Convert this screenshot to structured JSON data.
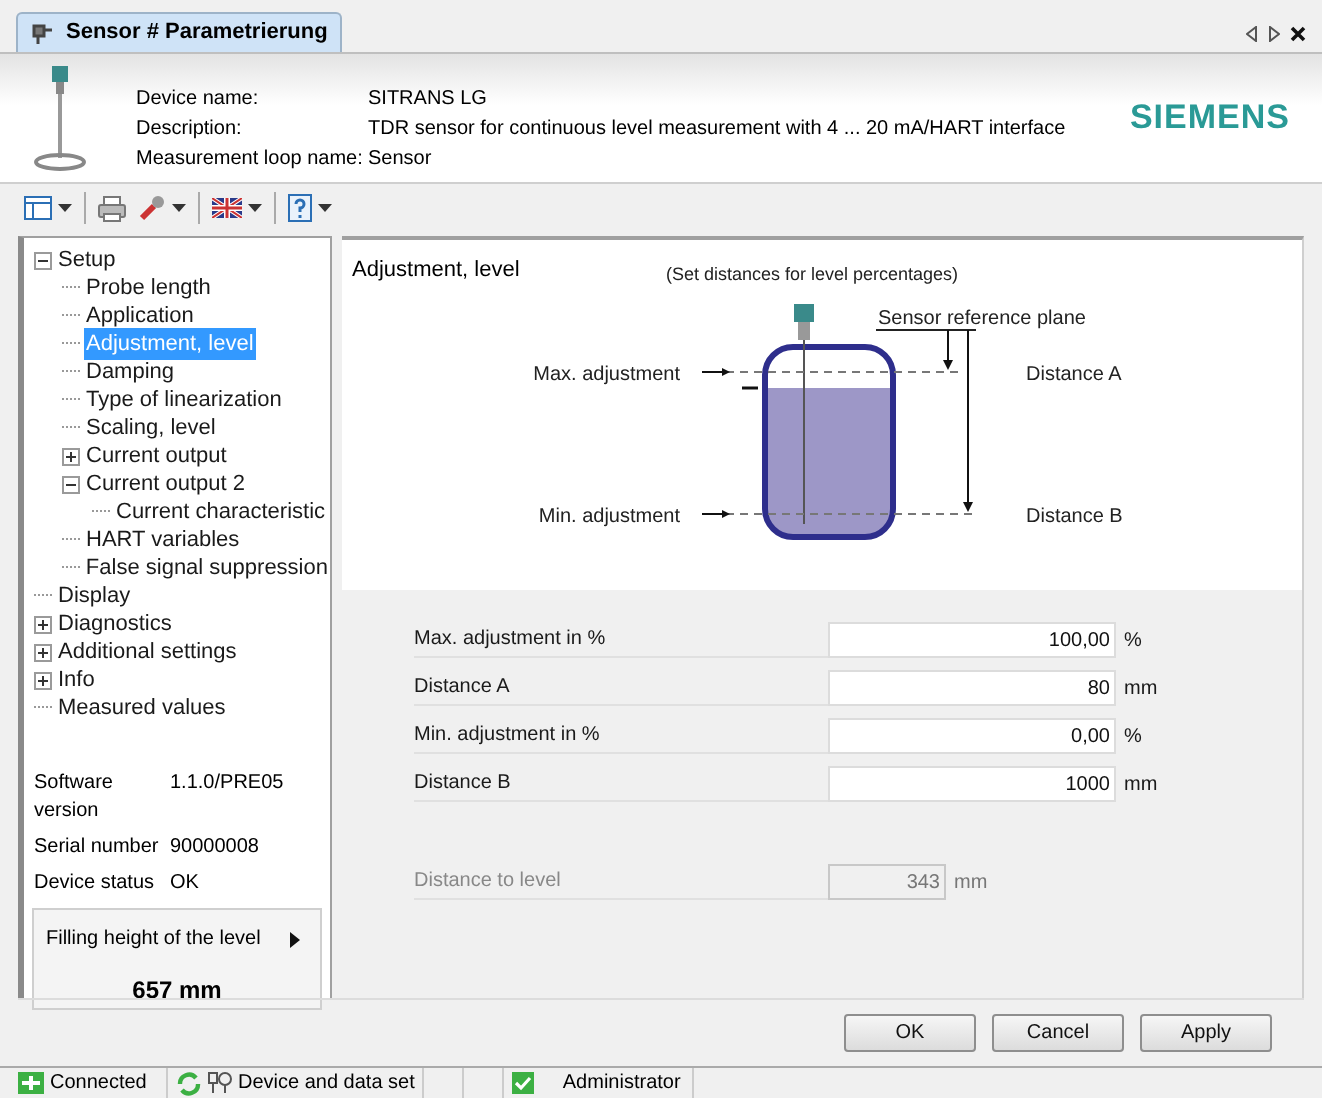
{
  "tab": {
    "label": "Sensor # Parametrierung",
    "selected": true
  },
  "device": {
    "fields": [
      {
        "label": "Device name:",
        "value": "SITRANS LG"
      },
      {
        "label": "Description:",
        "value": "TDR sensor for continuous level measurement with 4 ... 20 mA/HART interface"
      },
      {
        "label": "Measurement loop name:",
        "value": "Sensor"
      }
    ],
    "logo": "SIEMENS"
  },
  "tree": [
    {
      "label": "Setup",
      "expanded": true,
      "selected": false,
      "children": [
        {
          "label": "Probe length",
          "selected": false
        },
        {
          "label": "Application",
          "selected": false
        },
        {
          "label": "Adjustment, level",
          "selected": true
        },
        {
          "label": "Damping",
          "selected": false
        },
        {
          "label": "Type of linearization",
          "selected": false
        },
        {
          "label": "Scaling, level",
          "selected": false
        },
        {
          "label": "Current output",
          "expanded": false,
          "selected": false
        },
        {
          "label": "Current output 2",
          "expanded": true,
          "selected": false,
          "children": [
            {
              "label": "Current characteristic",
              "selected": false
            }
          ]
        },
        {
          "label": "HART variables",
          "selected": false
        },
        {
          "label": "False signal suppression",
          "selected": false
        }
      ]
    },
    {
      "label": "Display",
      "selected": false
    },
    {
      "label": "Diagnostics",
      "expanded": false,
      "selected": false
    },
    {
      "label": "Additional settings",
      "expanded": false,
      "selected": false
    },
    {
      "label": "Info",
      "expanded": false,
      "selected": false
    },
    {
      "label": "Measured values",
      "selected": false
    }
  ],
  "device_info": [
    {
      "label": "Software version",
      "value": "1.1.0/PRE05"
    },
    {
      "label": "Serial number",
      "value": "90000008"
    },
    {
      "label": "Device status",
      "value": "OK"
    }
  ],
  "measured": {
    "title": "Filling height of the level",
    "value": "657 mm"
  },
  "panel": {
    "title": "Adjustment, level",
    "diagram": {
      "caption": "(Set distances for level percentages)",
      "max_label": "Max. adjustment",
      "min_label": "Min. adjustment",
      "reference_label": "Sensor reference plane",
      "distance_a_label": "Distance A",
      "distance_b_label": "Distance B"
    },
    "fields": [
      {
        "label": "Max. adjustment in %",
        "value": "100,00",
        "unit": "%",
        "disabled": false
      },
      {
        "label": "Distance A",
        "value": "80",
        "unit": "mm",
        "disabled": false
      },
      {
        "label": "Min. adjustment in %",
        "value": "0,00",
        "unit": "%",
        "disabled": false
      },
      {
        "label": "Distance B",
        "value": "1000",
        "unit": "mm",
        "disabled": false
      },
      {
        "label": "Distance to level",
        "value": "343",
        "unit": "mm",
        "disabled": true
      }
    ]
  },
  "buttons": [
    "OK",
    "Cancel",
    "Apply"
  ],
  "status_bar": {
    "connection": "Connected",
    "dataset": "Device and data set",
    "user": "Administrator"
  }
}
